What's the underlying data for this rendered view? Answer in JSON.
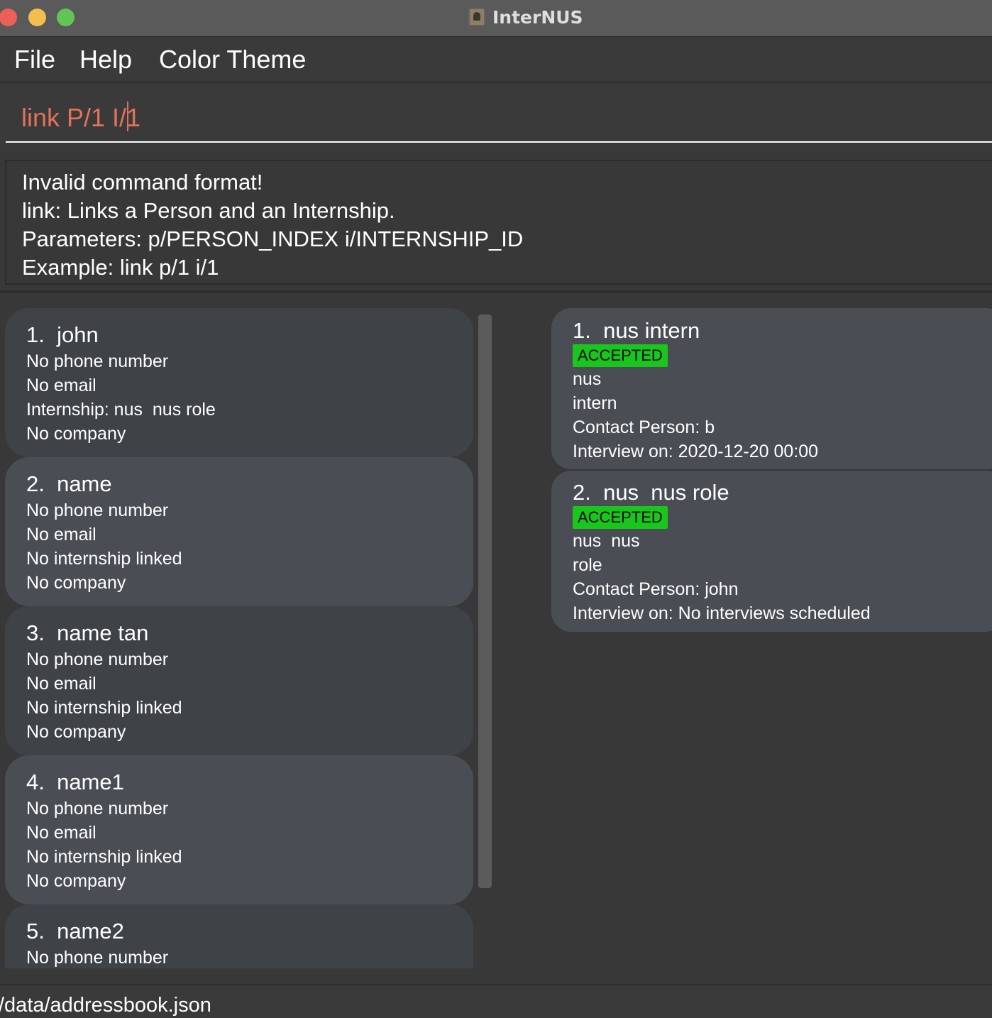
{
  "window": {
    "title": "InterNUS"
  },
  "menu": {
    "file": "File",
    "help": "Help",
    "color_theme": "Color Theme"
  },
  "command": {
    "value": "link P/1 I/1"
  },
  "result": {
    "lines": [
      "Invalid command format!",
      "link: Links a Person and an Internship.",
      "Parameters: p/PERSON_INDEX i/INTERNSHIP_ID",
      "Example: link p/1 i/1"
    ]
  },
  "persons": [
    {
      "title": "1.  john",
      "lines": [
        "No phone number",
        "No email",
        "Internship: nus  nus role",
        "No company"
      ]
    },
    {
      "title": "2.  name",
      "lines": [
        "No phone number",
        "No email",
        "No internship linked",
        "No company"
      ]
    },
    {
      "title": "3.  name tan",
      "lines": [
        "No phone number",
        "No email",
        "No internship linked",
        "No company"
      ]
    },
    {
      "title": "4.  name1",
      "lines": [
        "No phone number",
        "No email",
        "No internship linked",
        "No company"
      ]
    },
    {
      "title": "5.  name2",
      "lines": [
        "No phone number"
      ]
    }
  ],
  "internships": [
    {
      "title": "1.  nus intern",
      "status": "ACCEPTED",
      "lines": [
        "nus",
        "intern",
        "Contact Person: b",
        "Interview on: 2020-12-20 00:00"
      ]
    },
    {
      "title": "2.  nus  nus role",
      "status": "ACCEPTED",
      "lines": [
        "nus  nus",
        "role",
        "Contact Person: john",
        "Interview on: No interviews scheduled"
      ]
    }
  ],
  "status_bar": {
    "path": "/data/addressbook.json"
  },
  "colors": {
    "accepted": "#19c71c",
    "command_text": "#e2725b"
  }
}
